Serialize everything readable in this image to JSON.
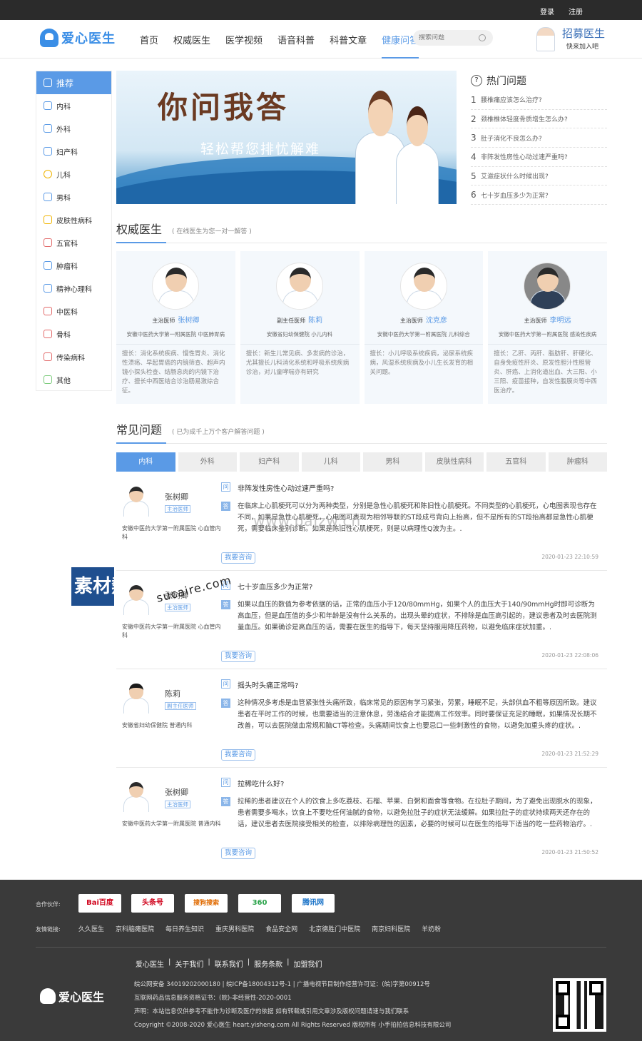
{
  "topbar": {
    "login": "登录",
    "register": "注册"
  },
  "brand": {
    "name": "爱心医生"
  },
  "nav": [
    {
      "label": "首页"
    },
    {
      "label": "权威医生"
    },
    {
      "label": "医学视频"
    },
    {
      "label": "语音科普"
    },
    {
      "label": "科普文章"
    },
    {
      "label": "健康问答",
      "active": true
    }
  ],
  "search": {
    "placeholder": "搜索问题"
  },
  "header_promo": {
    "title": "招募医生",
    "subtitle": "快来加入吧"
  },
  "sidebar": {
    "items": [
      {
        "label": "推荐",
        "icon": "thumbs-up-icon",
        "active": true
      },
      {
        "label": "内科",
        "icon": "heart-icon"
      },
      {
        "label": "外科",
        "icon": "hospital-icon"
      },
      {
        "label": "妇产科",
        "icon": "baby-icon"
      },
      {
        "label": "儿科",
        "icon": "smile-icon"
      },
      {
        "label": "男科",
        "icon": "heart-icon"
      },
      {
        "label": "皮肤性病科",
        "icon": "hand-icon"
      },
      {
        "label": "五官科",
        "icon": "ear-icon"
      },
      {
        "label": "肿瘤科",
        "icon": "cell-icon"
      },
      {
        "label": "精神心理科",
        "icon": "brain-icon"
      },
      {
        "label": "中医科",
        "icon": "herb-icon"
      },
      {
        "label": "骨科",
        "icon": "bone-icon"
      },
      {
        "label": "传染病科",
        "icon": "virus-icon"
      },
      {
        "label": "其他",
        "icon": "grid-icon"
      }
    ]
  },
  "banner": {
    "title": "你问我答",
    "subtitle": "轻松帮您排忧解难"
  },
  "hot": {
    "title": "热门问题",
    "items": [
      {
        "n": "1",
        "text": "腰椎痛应该怎么治疗?"
      },
      {
        "n": "2",
        "text": "颈椎椎体轻度骨质增生怎么办?"
      },
      {
        "n": "3",
        "text": "肚子消化不良怎么办?"
      },
      {
        "n": "4",
        "text": "非阵发性房性心动过速严重吗?"
      },
      {
        "n": "5",
        "text": "艾滋症状什么时候出现?"
      },
      {
        "n": "6",
        "text": "七十岁血压多少为正常?"
      }
    ]
  },
  "doctors_section": {
    "title": "权威医生",
    "subtitle": "( 在线医生为您一对一解答 )"
  },
  "doctors": [
    {
      "title": "主治医师",
      "name": "张树卿",
      "org": "安徽中医药大学第一附属医院 中医肺胃病",
      "skill": "擅长：消化系统疾病、慢性胃炎、消化性溃疡、早起胃癌的内镜筛查、超声内镜小探头检查、结肠息肉的内镜下治疗、擅长中西医结合诊治肠易激综合征。"
    },
    {
      "title": "副主任医师",
      "name": "陈莉",
      "org": "安徽省妇幼保健院 小儿内科",
      "skill": "擅长：新生儿常见病、多发病的诊治，尤其擅长儿科消化系统和呼吸系统疾病诊治，对儿童哮喘亦有研究"
    },
    {
      "title": "主治医师",
      "name": "沈克彦",
      "org": "安徽中医药大学第一附属医院 儿科综合",
      "skill": "擅长：小儿呼吸系统疾病，泌尿系统疾病，风湿系统疾病及小儿生长发育的相关问题。"
    },
    {
      "title": "主治医师",
      "name": "李明远",
      "org": "安徽中医药大学第一附属医院 感染性疾病",
      "skill": "擅长：乙肝、丙肝、脂肪肝、肝硬化、自身免疫性肝炎、原发性胆汁性胆管炎、肝癌、上消化道出血、大三阳、小三阳、疫苗接种，自发性腹膜炎等中西医治疗。"
    }
  ],
  "faq_section": {
    "title": "常见问题",
    "subtitle": "( 已为成千上万个客户解答问题 )"
  },
  "tabs": [
    {
      "label": "内科",
      "active": true
    },
    {
      "label": "外科"
    },
    {
      "label": "妇产科"
    },
    {
      "label": "儿科"
    },
    {
      "label": "男科"
    },
    {
      "label": "皮肤性病科"
    },
    {
      "label": "五官科"
    },
    {
      "label": "肿瘤科"
    }
  ],
  "qa": [
    {
      "doctor": "张树卿",
      "tag": "主治医师",
      "hospital": "安徽中医药大学第一附属医院 心血管内科",
      "q_icon": "问",
      "a_icon": "答",
      "question": "非阵发性房性心动过速严重吗?",
      "answer": "在临床上心肌梗死可以分为两种类型，分别是急性心肌梗死和陈旧性心肌梗死。不同类型的心肌梗死，心电图表现也存在不同，如果是急性心肌梗死，心电图可表现为相邻导联的ST段成弓背向上抬高，但不是所有的ST段抬高都是急性心肌梗死，需要临床鉴别诊断。如果是陈旧性心肌梗死，则是以病理性Q波为主。.",
      "ask": "我要咨询",
      "time": "2020-01-23 22:10:59"
    },
    {
      "doctor": "张树卿",
      "tag": "主治医师",
      "hospital": "安徽中医药大学第一附属医院 心血管内科",
      "q_icon": "问",
      "a_icon": "答",
      "question": "七十岁血压多少为正常?",
      "answer": "如果以血压的数值为参考依据的话，正常的血压小于120/80mmHg，如果个人的血压大于140/90mmHg时即可诊断为高血压，但是血压值的多少和年龄是没有什么关系的。出现头晕的症状，不排除是血压高引起的，建议患者及时去医院测量血压。如果确诊是高血压的话，需要在医生的指导下，每天坚持服用降压药物，以避免临床症状加重。.",
      "ask": "我要咨询",
      "time": "2020-01-23 22:08:06"
    },
    {
      "doctor": "陈莉",
      "tag": "副主任医师",
      "hospital": "安徽省妇幼保健院 普通内科",
      "q_icon": "问",
      "a_icon": "答",
      "question": "摇头时头痛正常吗?",
      "answer": "这种情况多考虑是血管紧张性头痛所致，临床常见的原因有学习紧张，劳累，睡眠不足，头部供血不粗等原因所致。建议患者在平时工作的时候，也需要适当的注意休息，劳逸结合才能提高工作效率。同时要保证充足的睡眠，如果情况长期不改善，可以去医院做血常规和脑CT等检查。头痛期间饮食上也要忌口一些刺激性的食物，以避免加重头疼的症状。.",
      "ask": "我要咨询",
      "time": "2020-01-23 21:52:29"
    },
    {
      "doctor": "张树卿",
      "tag": "主治医师",
      "hospital": "安徽中医药大学第一附属医院 普通内科",
      "q_icon": "问",
      "a_icon": "答",
      "question": "拉稀吃什么好?",
      "answer": "拉稀的患者建议在个人的饮食上多吃荔枝、石榴、苹果、白粥和面食等食物。在拉肚子期间，为了避免出现脱水的现象，患者需要多喝水，饮食上不要吃任何油腻的食物，以避免拉肚子的症状无法缓解。如果拉肚子的症状持续两天还存在的话，建议患者去医院接受相关的检查，以排除病理性的因素，必要的时候可以在医生的指导下适当的吃一些药物治疗。.",
      "ask": "我要咨询",
      "time": "2020-01-23 21:50:52"
    }
  ],
  "footer": {
    "partners_label": "合作伙伴:",
    "partners": [
      "Bai百度",
      "头条号",
      "搜狗搜索",
      "360",
      "腾讯网"
    ],
    "links_label": "友情链接:",
    "links": [
      "久久医生",
      "京科脑瘫医院",
      "每日养生知识",
      "重庆男科医院",
      "食品安全网",
      "北京德胜门中医院",
      "南京妇科医院",
      "羊奶粉"
    ],
    "nav": [
      "爱心医生",
      "|",
      "关于我们",
      "|",
      "联系我们",
      "|",
      "服务条款",
      "|",
      "加盟我们"
    ],
    "record": "皖公网安备 34019202000180 | 皖ICP备18004312号-1 | 广播电视节目制作经营许可证：(皖)字第00912号",
    "license": "互联网药品信息服务资格证书：(皖)-非经营性-2020-0001",
    "notice": "声明：本站信息仅供参考不能作为诊断及医疗的依据 如有转载或引用文章涉及版权问题请速与我们联系",
    "copyright": "Copyright ©2008-2020 爱心医生 heart.yisheng.com All Rights Reserved 版权所有 小手拍拍信息科技有限公司",
    "brand": "爱心医生"
  },
  "watermarks": {
    "center": "www.paizw.cn",
    "logo_text": "素材熱",
    "logo_url": "sucaire.com"
  }
}
